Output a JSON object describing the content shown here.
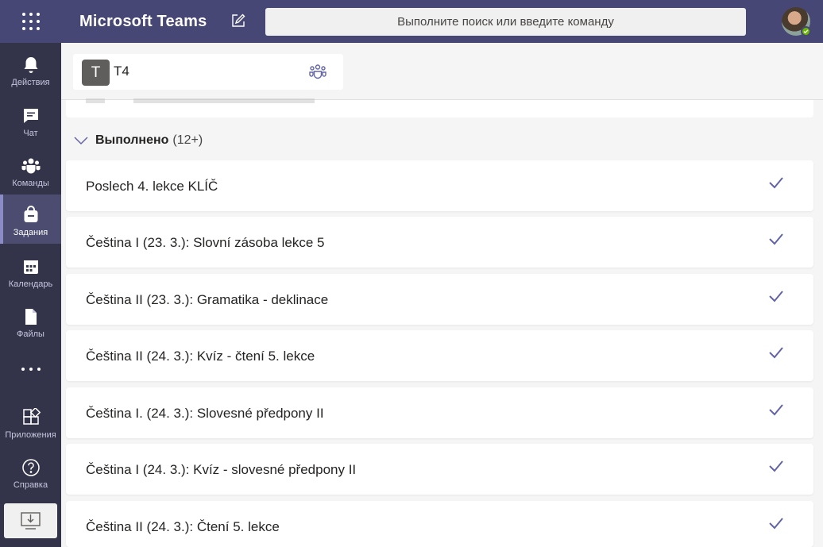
{
  "app": {
    "title": "Microsoft Teams"
  },
  "search": {
    "placeholder": "Выполните поиск или введите команду"
  },
  "rail": {
    "items": [
      {
        "label": "Действия",
        "icon": "bell-icon"
      },
      {
        "label": "Чат",
        "icon": "chat-icon"
      },
      {
        "label": "Команды",
        "icon": "teams-icon"
      },
      {
        "label": "Задания",
        "icon": "assignments-icon",
        "active": true
      },
      {
        "label": "Календарь",
        "icon": "calendar-icon"
      },
      {
        "label": "Файлы",
        "icon": "files-icon"
      },
      {
        "label": "Приложения",
        "icon": "apps-icon"
      },
      {
        "label": "Справка",
        "icon": "help-icon"
      }
    ]
  },
  "team": {
    "initial": "T",
    "name": "T4"
  },
  "section": {
    "title": "Выполнено",
    "count": "(12+)"
  },
  "assignments": [
    {
      "title": "Poslech 4. lekce KLÍČ"
    },
    {
      "title": "Čeština I (23. 3.): Slovní zásoba lekce 5"
    },
    {
      "title": "Čeština II (23. 3.): Gramatika - deklinace"
    },
    {
      "title": "Čeština II (24. 3.): Kvíz - čtení 5. lekce"
    },
    {
      "title": "Čeština I. (24. 3.): Slovesné předpony II"
    },
    {
      "title": "Čeština I (24. 3.): Kvíz - slovesné předpony II"
    },
    {
      "title": "Čeština II (24. 3.): Čtení 5. lekce"
    }
  ],
  "colors": {
    "topbar": "#464775",
    "rail": "#33344a",
    "accent": "#6264a7",
    "presence": "#6bb700"
  }
}
